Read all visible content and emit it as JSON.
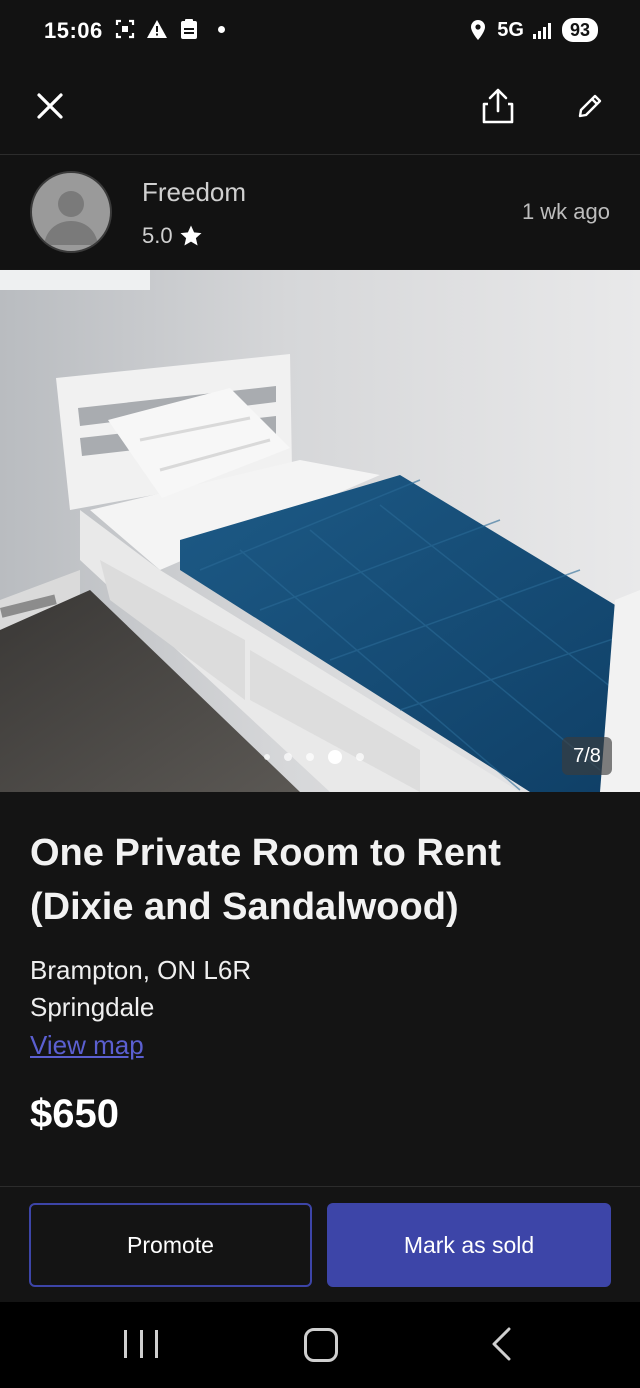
{
  "status_bar": {
    "time": "15:06",
    "network": "5G",
    "battery": "93",
    "icons": [
      "screenshot-icon",
      "warning-icon",
      "clipboard-icon",
      "notification-dot",
      "location-icon",
      "signal-icon"
    ]
  },
  "app_bar": {
    "icons": [
      "close-icon",
      "share-icon",
      "edit-icon"
    ]
  },
  "seller": {
    "name": "Freedom",
    "rating": "5.0",
    "posted": "1 wk  ago"
  },
  "gallery": {
    "counter": "7/8",
    "dot_count": 5,
    "active_dot": 4
  },
  "listing": {
    "title": "One Private Room to Rent (Dixie and Sandalwood)",
    "location_line1": "Brampton, ON L6R",
    "location_line2": "Springdale",
    "view_map_label": "View map",
    "price": "$650"
  },
  "actions": {
    "promote_label": "Promote",
    "mark_sold_label": "Mark as sold"
  },
  "colors": {
    "accent": "#3d45a8",
    "link": "#5b5fd0",
    "background": "#141414"
  }
}
